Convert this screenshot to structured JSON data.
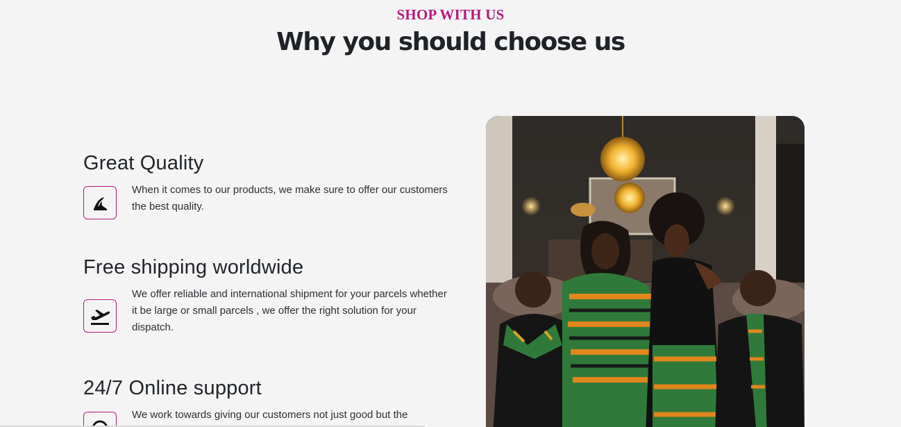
{
  "header": {
    "eyebrow": "SHOP WITH US",
    "title": "Why you should choose us"
  },
  "features": [
    {
      "title": "Great Quality",
      "icon": "quality-fin-icon",
      "description": "When it comes to our products, we make sure to offer our customers the best quality."
    },
    {
      "title": "Free shipping worldwide",
      "icon": "airplane-departure-icon",
      "description": "We offer reliable and international shipment for your parcels whether it be large or small parcels , we offer the right solution for your dispatch."
    },
    {
      "title": "24/7 Online support",
      "icon": "support-icon",
      "description": "We work towards giving our customers not just good but the"
    }
  ],
  "image": {
    "subject": "group-photo",
    "alt": ""
  },
  "colors": {
    "accent": "#b5197c",
    "background": "#f4f4f5",
    "heading": "#1f2328",
    "text": "#2b2f33"
  }
}
